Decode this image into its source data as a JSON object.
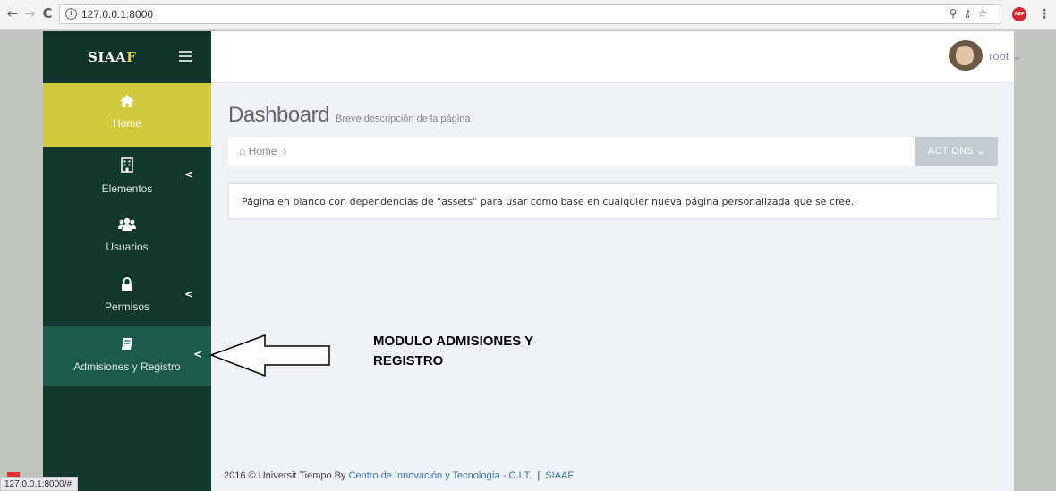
{
  "browser": {
    "url": "127.0.0.1:8000",
    "info_glyph": "i",
    "status_url": "127.0.0.1:8000/#"
  },
  "brand": {
    "name_part1": "SIAA",
    "name_part2": "F"
  },
  "sidebar": {
    "items": [
      {
        "label": "Home",
        "icon": "home-icon"
      },
      {
        "label": "Elementos",
        "icon": "building-icon"
      },
      {
        "label": "Usuarios",
        "icon": "users-icon"
      },
      {
        "label": "Permisos",
        "icon": "lock-icon"
      },
      {
        "label": "Admisiones y Registro",
        "icon": "book-icon"
      }
    ]
  },
  "header": {
    "user_name": "root"
  },
  "page": {
    "title": "Dashboard",
    "subtitle": "Breve descripción de la página",
    "breadcrumb": "Home",
    "actions_label": "ACTIONS",
    "note": "Página en blanco con dependencias de \"assets\" para usar como base en cualquier nueva página personalizada que se cree."
  },
  "footer": {
    "prefix": "2016 © Universit Tiempo By",
    "link_text": "Centro de Innovación y Tecnología - C.I.T.",
    "separator": "|",
    "app": "SIAAF"
  },
  "annotation": {
    "line1": "MODULO ADMISIONES Y",
    "line2": "REGISTRO"
  },
  "colors": {
    "sidebar_bg": "#11392d",
    "active_item": "#d2c93e",
    "brand_accent": "#e1cf3b",
    "main_bg": "#eef1f5",
    "actions_btn": "#c5ccd4"
  }
}
